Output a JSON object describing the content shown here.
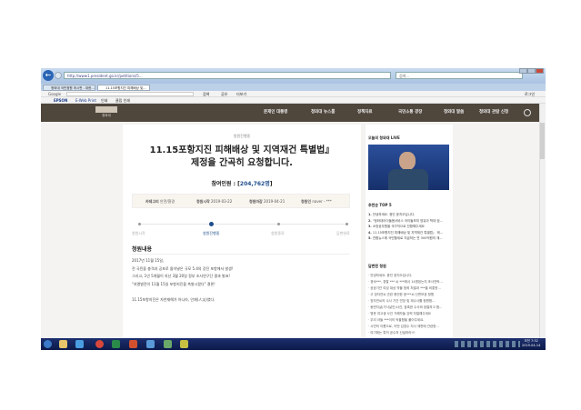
{
  "browser": {
    "address": "http://www1.president.go.kr/petitions/5...",
    "search_placeholder": "검색...",
    "tabs": [
      "청와대 국민청원 게시판 - 대한...",
      "11.15포항지진 피해배상 및..."
    ],
    "google_label": "Google",
    "google_tools": [
      "검색",
      "공유",
      "더보기"
    ],
    "login": "로그인",
    "epson_label": "EPSON",
    "epson_tools": [
      "E-Web Print",
      "인쇄",
      "클립 인쇄"
    ]
  },
  "site": {
    "logo": "청와대",
    "nav": [
      "문재인 대통령",
      "청와대 뉴스룸",
      "정책자료",
      "국민소통 광장",
      "청와대 말씀",
      "청와대 관람 신청"
    ]
  },
  "petition": {
    "status": "청원진행중",
    "title_line1": "11.15포항지진 피해배상 및 지역재건 특별법』",
    "title_line2": "제정을 간곡히 요청합니다.",
    "participants_label": "참여인원 : [",
    "participants": "204,762명",
    "participants_close": "]",
    "meta": [
      {
        "label": "카테고리",
        "value": "안전/환경"
      },
      {
        "label": "청원시작",
        "value": "2019-03-22"
      },
      {
        "label": "청원마감",
        "value": "2019-04-21"
      },
      {
        "label": "청원인",
        "value": "naver - ***"
      }
    ],
    "steps": [
      "청원시작",
      "청원진행중",
      "청원종료",
      "답변완료"
    ],
    "active_step": 1,
    "content_heading": "청원내용",
    "content": [
      "2017년 11월 15일,",
      "전 국민을 충격과 공포로 몰아넣은 규모 5.4의 강진 포항에서 발생!",
      "그리고, 1년 5개월이 지난 3월 20일 정부 조사연구단 결과 발표!",
      "\"지열발전이 11월 15일 포항지진을 촉발시켰다\" 결론!",
      "",
      "11.15포항지진은 자연재해가 아니라, 인재(人災)였다."
    ]
  },
  "sidebar": {
    "live_title": "오늘의 청와대 LIVE",
    "top5_title": "추천순 TOP 5",
    "top5": [
      "안녕하세요. 증인 윤지오입니다.",
      "\"청와대아이돌봄서비스 아이돌보미 영유아 학대 엄...",
      "소방공무원을 국가직으로 전환해주세요",
      "11.15포항지진 피해배상 및 지역재건 특별법』 제...",
      "연합뉴스에 국민혈세로 지급하는 연 300억원의 재..."
    ],
    "answered_title": "답변된 청원",
    "answered": [
      "안녕하세요. 증인 윤지오입니다.",
      "경숙***, 경찰 *** 씨 ***에서 14명된는지 조사연락...",
      "공공기관 여성 대상 약물 범죄 처벌과 ***을 비롯한...",
      "고 장자연씨 관련 증언한 윤***씨 신변보호 청원",
      "장자연씨의 수사 기간 연장 및 재수사를 청원합...",
      "동반자살(가사살인)사건, 참혹한 수사와 엄벌하고 합...",
      "명문 여고생 사건 가해자들 강력 처벌해주세요",
      "우리 아들 ***이의 억울함을 풀어주세요.",
      "시민의 이름으로, 이번 김경수 지사 재판에 관련한...",
      "여기에는 특히 공수처 신설하라!!!"
    ]
  },
  "taskbar": {
    "time": "오전 7:32",
    "date": "2019-04-14"
  },
  "colors": {
    "nav_bg": "#4f463c",
    "accent": "#1f4e8c",
    "taskbar": "#13245c"
  }
}
